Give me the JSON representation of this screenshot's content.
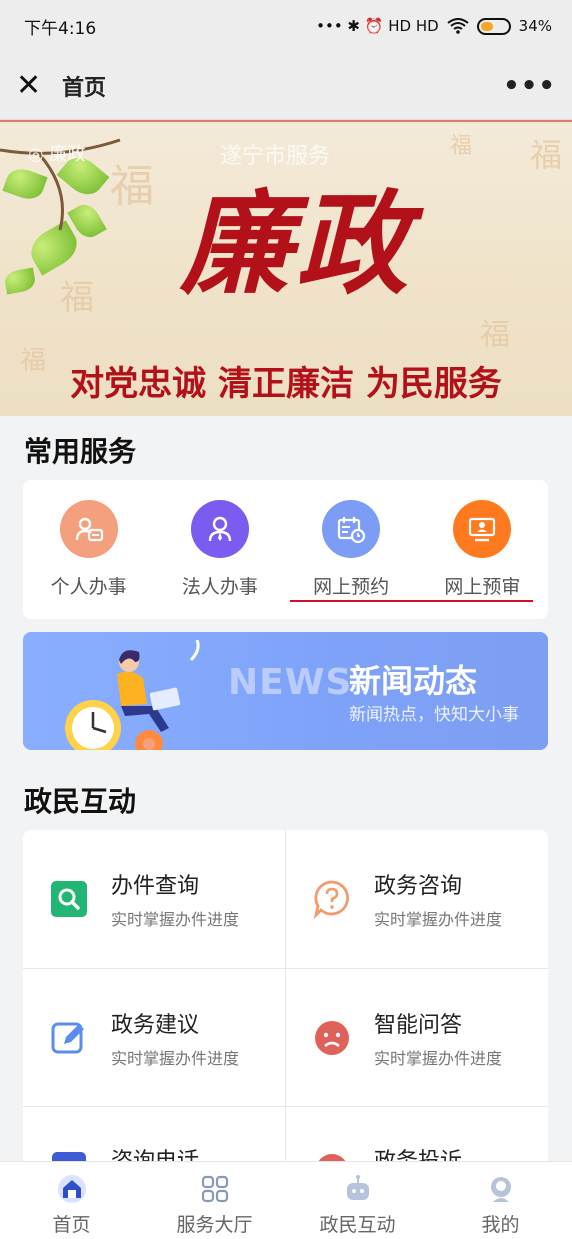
{
  "status_bar": {
    "time": "下午4:16",
    "battery": "34%",
    "signal_icons": "••• ✱ ⏰ HD HD"
  },
  "nav": {
    "title": "首页"
  },
  "banner": {
    "title": "廉政",
    "slogan": "对党忠诚 清正廉洁 为民服务",
    "city_text": "遂宁市服务",
    "fu_char": "福"
  },
  "common_services": {
    "title": "常用服务",
    "items": [
      {
        "label": "个人办事",
        "icon": "person-card-icon",
        "color": "#f4a07e"
      },
      {
        "label": "法人办事",
        "icon": "legal-person-icon",
        "color": "#7b5cf0"
      },
      {
        "label": "网上预约",
        "icon": "calendar-clock-icon",
        "color": "#7d9cf3"
      },
      {
        "label": "网上预审",
        "icon": "monitor-icon",
        "color": "#ff7a1f"
      }
    ]
  },
  "news": {
    "en": "NEWS",
    "title": "新闻动态",
    "subtitle": "新闻热点，快知大小事"
  },
  "interaction": {
    "title": "政民互动",
    "items": [
      {
        "title": "办件查询",
        "sub": "实时掌握办件进度",
        "icon": "search-icon",
        "color": "#22b573"
      },
      {
        "title": "政务咨询",
        "sub": "实时掌握办件进度",
        "icon": "question-bubble-icon",
        "color": "#f19a6c"
      },
      {
        "title": "政务建议",
        "sub": "实时掌握办件进度",
        "icon": "edit-icon",
        "color": "#5b8def"
      },
      {
        "title": "智能问答",
        "sub": "实时掌握办件进度",
        "icon": "robot-face-icon",
        "color": "#e0605a"
      },
      {
        "title": "咨询电话",
        "sub": "",
        "icon": "phone-icon",
        "color": "#3f5bd6"
      },
      {
        "title": "政务投诉",
        "sub": "",
        "icon": "complaint-icon",
        "color": "#e0605a"
      }
    ]
  },
  "tab_bar": {
    "items": [
      {
        "label": "首页",
        "icon": "home-icon",
        "active": true
      },
      {
        "label": "服务大厅",
        "icon": "grid-icon",
        "active": false
      },
      {
        "label": "政民互动",
        "icon": "robot-icon",
        "active": false
      },
      {
        "label": "我的",
        "icon": "user-icon",
        "active": false
      }
    ]
  },
  "colors": {
    "accent_red": "#d0102a",
    "banner_red": "#b3111a",
    "news_blue": "#7ea2f8"
  }
}
